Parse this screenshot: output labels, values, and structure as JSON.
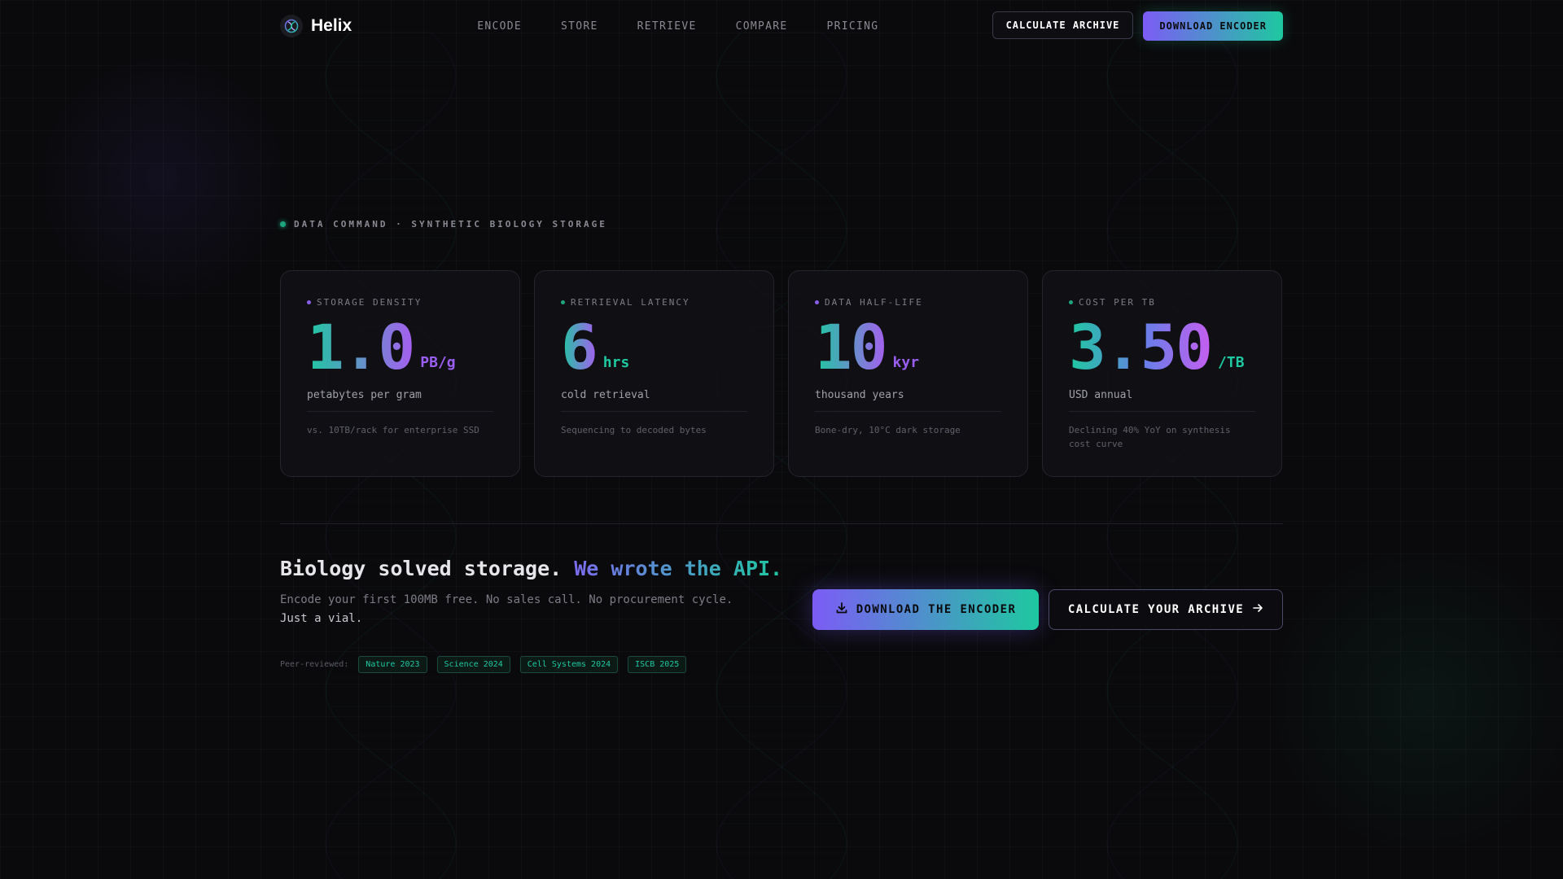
{
  "nav": {
    "brand": "Helix",
    "links": [
      "ENCODE",
      "STORE",
      "RETRIEVE",
      "COMPARE",
      "PRICING"
    ],
    "calculate_label": "CALCULATE ARCHIVE",
    "download_label": "DOWNLOAD ENCODER"
  },
  "eyebrow": "DATA COMMAND · SYNTHETIC BIOLOGY STORAGE",
  "cards": [
    {
      "label": "STORAGE DENSITY",
      "value": "1.0",
      "unit": "PB/g",
      "unit_color": "#9a5ef0",
      "dot_color": "#8a5ef0",
      "desc": "petabytes per gram",
      "note": "vs. 10TB/rack for enterprise SSD"
    },
    {
      "label": "RETRIEVAL LATENCY",
      "value": "6",
      "unit": "hrs",
      "unit_color": "#1ec8a0",
      "dot_color": "#1ea57e",
      "desc": "cold retrieval",
      "note": "Sequencing to decoded bytes"
    },
    {
      "label": "DATA HALF-LIFE",
      "value": "10",
      "unit": "kyr",
      "unit_color": "#9a5ef0",
      "dot_color": "#8a5ef0",
      "desc": "thousand years",
      "note": "Bone-dry, 10°C dark storage"
    },
    {
      "label": "COST PER TB",
      "value": "3.50",
      "unit": "/TB",
      "unit_color": "#1ec8a0",
      "dot_color": "#1ea57e",
      "desc": "USD annual",
      "note": "Declining 40% YoY on synthesis cost curve"
    }
  ],
  "cta": {
    "title_plain": "Biology solved storage. ",
    "title_accent": "We wrote the API.",
    "sub_plain": "Encode your first 100MB free. No sales call. No procurement cycle.",
    "sub_strong": "Just a vial.",
    "download_label": "DOWNLOAD THE ENCODER",
    "calculate_label": "CALCULATE YOUR ARCHIVE"
  },
  "peer": {
    "label": "Peer-reviewed:",
    "tags": [
      "Nature 2023",
      "Science 2024",
      "Cell Systems 2024",
      "ISCB 2025"
    ]
  },
  "colors": {
    "accent_purple": "#7c5cf5",
    "accent_teal": "#1ec8a0",
    "background": "#0a0a0c"
  },
  "icons": [
    "helix-logo-icon",
    "download-icon",
    "arrow-right-icon"
  ]
}
